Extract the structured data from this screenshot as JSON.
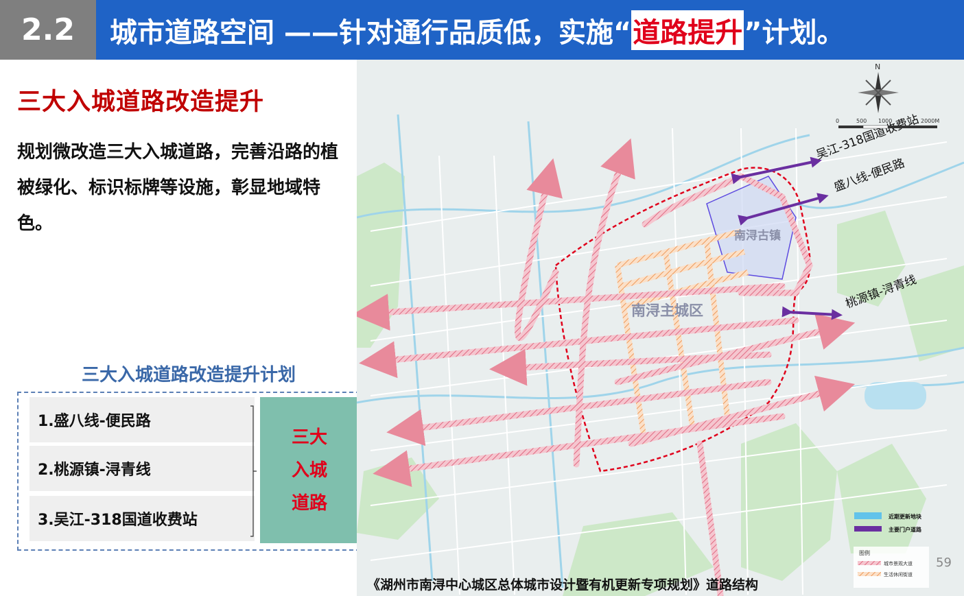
{
  "header": {
    "section_number": "2.2",
    "title_prefix": "城市道路空间  ——针对通行品质低，实施“",
    "title_highlight": "道路提升",
    "title_suffix": "”计划。",
    "bar_color": "#1f63c6",
    "highlight_color": "#e0001b"
  },
  "left": {
    "heading": "三大入城道路改造提升",
    "body": "规划微改造三大入城道路，完善沿路的植被绿化、标识标牌等设施，彰显地域特色。",
    "plan_title": "三大入城道路改造提升计划",
    "items": [
      "1.盛八线-便民路",
      "2.桃源镇-浔青线",
      "3.吴江-318国道收费站"
    ],
    "tag": [
      "三大",
      "入城",
      "道路"
    ]
  },
  "map": {
    "compass_letter": "N",
    "scale_labels": [
      "0",
      "500",
      "1000",
      "2000M"
    ],
    "road_labels": [
      "吴江-318国道收费站",
      "盛八线-便民路",
      "桃源镇-浔青线"
    ],
    "area_labels": {
      "old_town": "南浔古镇",
      "main_city": "南浔主城区"
    },
    "legend": {
      "title": "图例",
      "update_plot": "近期更新地块",
      "gateway_road": "主要门户道路",
      "urban_avenue": "城市景观大道",
      "leisure_street": "生活休闲街道"
    },
    "colors": {
      "gateway": "#6a2fa0",
      "avenue": "#e88a9b",
      "leisure": "#f0a66a",
      "update": "#62c3ea"
    }
  },
  "caption": "《湖州市南浔中心城区总体城市设计暨有机更新专项规划》道路结构",
  "page_number": "59"
}
